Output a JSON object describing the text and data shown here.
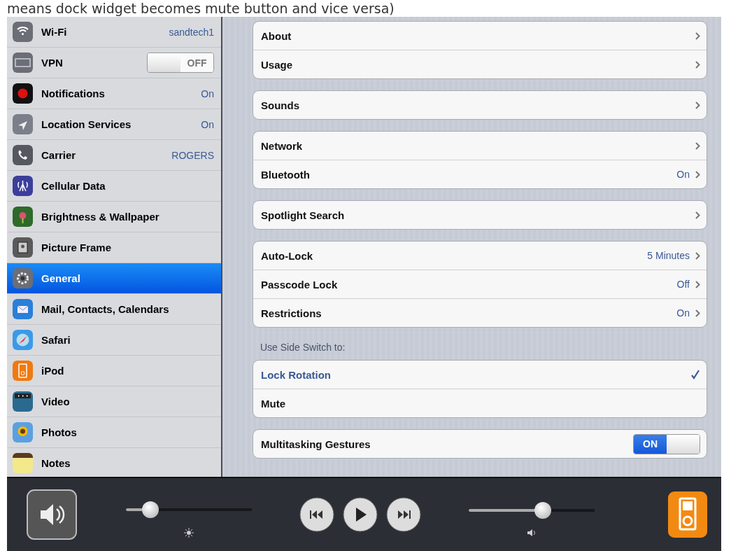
{
  "caption": "means dock widget becomes mute button and vice versa)",
  "sidebar": {
    "items": [
      {
        "label": "Wi-Fi",
        "kind": "value",
        "value": "sandtech1",
        "selected": false
      },
      {
        "label": "VPN",
        "kind": "switch",
        "on": false,
        "switch_label": "OFF",
        "selected": false
      },
      {
        "label": "Notifications",
        "kind": "value",
        "value": "On",
        "selected": false
      },
      {
        "label": "Location Services",
        "kind": "value",
        "value": "On",
        "selected": false
      },
      {
        "label": "Carrier",
        "kind": "value",
        "value": "ROGERS",
        "selected": false
      },
      {
        "label": "Cellular Data",
        "kind": "plain",
        "selected": false
      },
      {
        "label": "Brightness & Wallpaper",
        "kind": "plain",
        "selected": false
      },
      {
        "label": "Picture Frame",
        "kind": "plain",
        "selected": false
      },
      {
        "label": "General",
        "kind": "plain",
        "selected": true
      },
      {
        "label": "Mail, Contacts, Calendars",
        "kind": "plain",
        "selected": false
      },
      {
        "label": "Safari",
        "kind": "plain",
        "selected": false
      },
      {
        "label": "iPod",
        "kind": "plain",
        "selected": false
      },
      {
        "label": "Video",
        "kind": "plain",
        "selected": false
      },
      {
        "label": "Photos",
        "kind": "plain",
        "selected": false
      },
      {
        "label": "Notes",
        "kind": "plain",
        "selected": false
      }
    ]
  },
  "settings": {
    "groups": [
      {
        "rows": [
          {
            "label": "About",
            "kind": "link"
          },
          {
            "label": "Usage",
            "kind": "link"
          }
        ]
      },
      {
        "rows": [
          {
            "label": "Sounds",
            "kind": "link"
          }
        ]
      },
      {
        "rows": [
          {
            "label": "Network",
            "kind": "link"
          },
          {
            "label": "Bluetooth",
            "kind": "link",
            "value": "On"
          }
        ]
      },
      {
        "rows": [
          {
            "label": "Spotlight Search",
            "kind": "link"
          }
        ]
      },
      {
        "rows": [
          {
            "label": "Auto-Lock",
            "kind": "link",
            "value": "5 Minutes"
          },
          {
            "label": "Passcode Lock",
            "kind": "link",
            "value": "Off"
          },
          {
            "label": "Restrictions",
            "kind": "link",
            "value": "On"
          }
        ]
      },
      {
        "header": "Use Side Switch to:",
        "rows": [
          {
            "label": "Lock Rotation",
            "kind": "check",
            "checked": true
          },
          {
            "label": "Mute",
            "kind": "check",
            "checked": false
          }
        ]
      },
      {
        "rows": [
          {
            "label": "Multitasking Gestures",
            "kind": "switch",
            "on": true,
            "switch_label": "ON"
          }
        ]
      }
    ]
  },
  "dock": {
    "brightness": {
      "level": 0.15
    },
    "volume": {
      "level": 0.6
    }
  }
}
